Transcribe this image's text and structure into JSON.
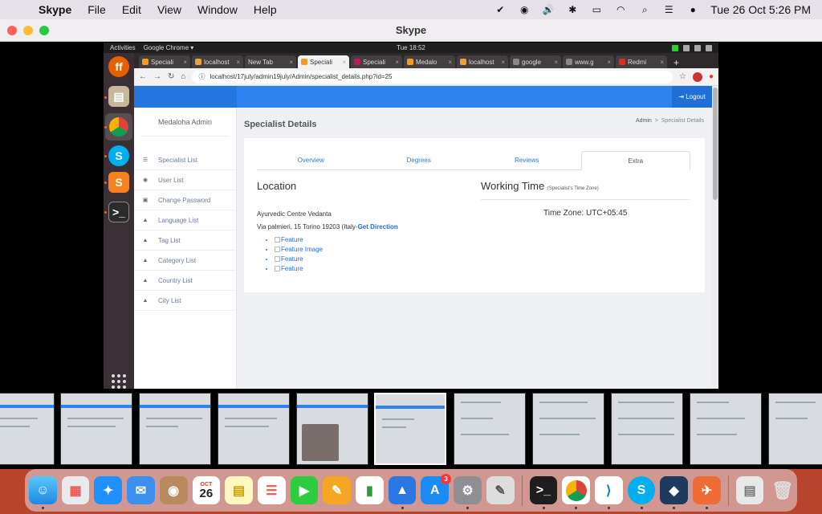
{
  "menubar": {
    "app_name": "Skype",
    "items": [
      "File",
      "Edit",
      "View",
      "Window",
      "Help"
    ],
    "datetime": "Tue 26 Oct  5:26 PM"
  },
  "skype": {
    "title": "Skype"
  },
  "ubuntu": {
    "activities": "Activities",
    "chrome_label": "Google Chrome ▾",
    "clock": "Tue 18:52"
  },
  "chrome": {
    "tabs": [
      {
        "label": "Speciali",
        "color": "#f59b21"
      },
      {
        "label": "localhost",
        "color": "#e8a33c"
      },
      {
        "label": "New Tab",
        "color": "#888888"
      },
      {
        "label": "Speciali",
        "color": "#f59b21"
      },
      {
        "label": "Speciali",
        "color": "#c2185b"
      },
      {
        "label": "Medalo",
        "color": "#f59b21"
      },
      {
        "label": "localhost",
        "color": "#e8a33c"
      },
      {
        "label": "google",
        "color": "#888888"
      },
      {
        "label": "www.g",
        "color": "#888888"
      },
      {
        "label": "Redmi",
        "color": "#d93025"
      }
    ],
    "new_tab": "+",
    "url": "localhost/17july/admin19july/Admin/specialist_details.php?id=25"
  },
  "app": {
    "brand": "Medaloha Admin",
    "logout": "Logout",
    "nav": [
      "Specialist List",
      "User List",
      "Change Password",
      "Language List",
      "Tag List",
      "Category List",
      "Country List",
      "City List"
    ],
    "page_title": "Specialist Details",
    "breadcrumb": {
      "home": "Admin",
      "sep": ">",
      "current": "Specialist Details"
    },
    "tabs": [
      "Overview",
      "Degrees",
      "Reviews",
      "Extra"
    ],
    "active_tab": "Extra",
    "location_heading": "Location",
    "working_heading": "Working Time",
    "working_sub": "(Specialist's Time Zone)",
    "address_name": "Ayurvedic Centre Vedanta",
    "address_line": "Via palmieri, 15 Torino 19203 (Italy-",
    "get_direction": "Get Direction",
    "timezone": "Time Zone: UTC+05:45",
    "features": [
      "Feature",
      "Feature Image",
      "Feature",
      "Feature"
    ]
  },
  "dock_calendar": {
    "month": "OCT",
    "day": "26"
  },
  "dock_badge": "3"
}
